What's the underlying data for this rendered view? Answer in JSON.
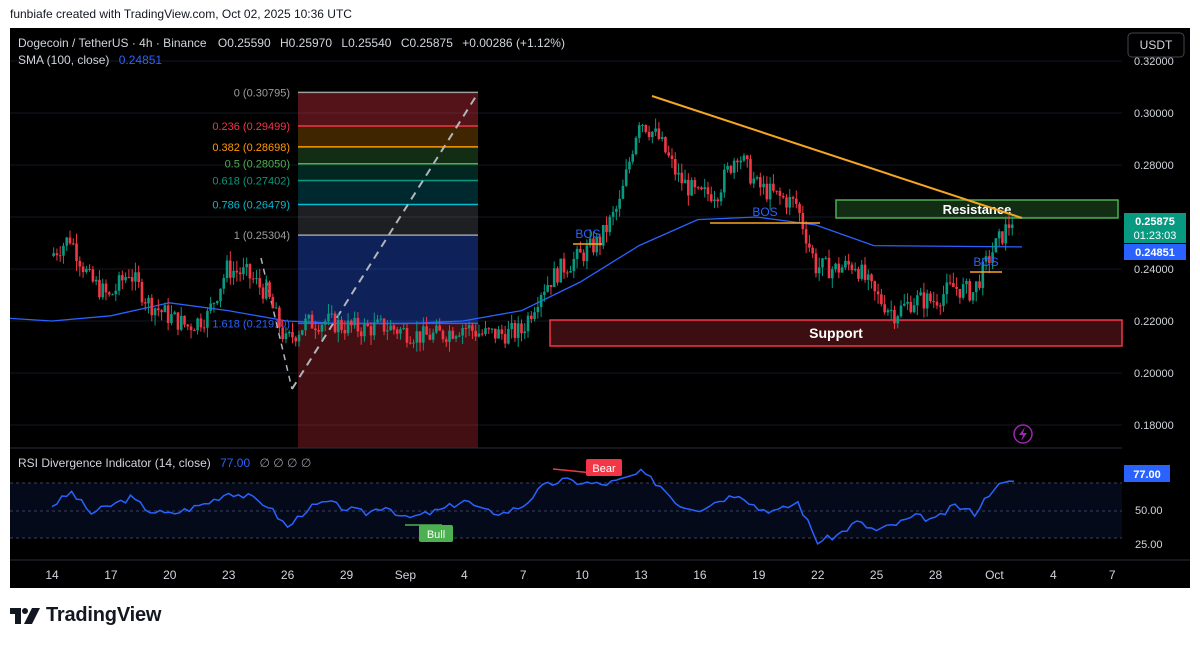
{
  "header": {
    "credit": "funbiafe created with TradingView.com, Oct 02, 2025 10:36 UTC"
  },
  "legend": {
    "symbol": "Dogecoin / TetherUS · 4h · Binance",
    "open_label": "O",
    "open": "0.25590",
    "high_label": "H",
    "high": "0.25970",
    "low_label": "L",
    "low": "0.25540",
    "close_label": "C",
    "close": "0.25875",
    "change": "+0.00286 (+1.12%)",
    "sma_label": "SMA (100, close)",
    "sma_value": "0.24851"
  },
  "currency_button": "USDT",
  "price_axis": {
    "ticks": [
      "0.32000",
      "0.30000",
      "0.28000",
      "0.26000",
      "0.24000",
      "0.22000",
      "0.20000",
      "0.18000"
    ],
    "last_price": "0.25875",
    "countdown": "01:23:03",
    "sma_badge": "0.24851"
  },
  "fib_levels": [
    {
      "ratio": "0",
      "price": "0.30795",
      "label": "0 (0.30795)",
      "color": "#9e9e9e"
    },
    {
      "ratio": "0.236",
      "price": "0.29499",
      "label": "0.236 (0.29499)",
      "color": "#f23645"
    },
    {
      "ratio": "0.382",
      "price": "0.28698",
      "label": "0.382 (0.28698)",
      "color": "#ff9800"
    },
    {
      "ratio": "0.5",
      "price": "0.28050",
      "label": "0.5 (0.28050)",
      "color": "#4caf50"
    },
    {
      "ratio": "0.618",
      "price": "0.27402",
      "label": "0.618 (0.27402)",
      "color": "#089981"
    },
    {
      "ratio": "0.786",
      "price": "0.26479",
      "label": "0.786 (0.26479)",
      "color": "#00bcd4"
    },
    {
      "ratio": "1",
      "price": "0.25304",
      "label": "1 (0.25304)",
      "color": "#9e9e9e"
    },
    {
      "ratio": "1.618",
      "price": "0.21910",
      "label": "1.618 (0.21910)",
      "color": "#2962ff"
    }
  ],
  "annotations": {
    "resistance": "Resistance",
    "support": "Support",
    "bos_1": "BOS",
    "bos_2": "BOS",
    "bos_3": "BOS",
    "bear": "Bear",
    "bull": "Bull"
  },
  "rsi": {
    "title": "RSI Divergence Indicator (14, close)",
    "value": "77.00",
    "placeholders": "∅ ∅ ∅ ∅",
    "ticks": [
      "50.00",
      "25.00"
    ],
    "badge": "77.00"
  },
  "time_axis": [
    "14",
    "17",
    "20",
    "23",
    "26",
    "29",
    "Sep",
    "4",
    "7",
    "10",
    "13",
    "16",
    "19",
    "22",
    "25",
    "28",
    "Oct",
    "4",
    "7"
  ],
  "footer": {
    "brand": "TradingView"
  },
  "colors": {
    "up": "#089981",
    "down": "#f23645",
    "sma": "#2962ff",
    "trend": "#f5a623",
    "rsi": "#2962ff",
    "resistance": "#4caf50",
    "support": "#f23645"
  },
  "chart_data": {
    "type": "candlestick",
    "instrument": "Dogecoin / TetherUS",
    "interval": "4h",
    "exchange": "Binance",
    "ylim": [
      0.17,
      0.325
    ],
    "x_labels": [
      "14",
      "17",
      "20",
      "23",
      "26",
      "29",
      "Sep",
      "4",
      "7",
      "10",
      "13",
      "16",
      "19",
      "22",
      "25",
      "28",
      "Oct",
      "4",
      "7"
    ],
    "approx_close_path": [
      {
        "x": "14",
        "y": 0.245
      },
      {
        "x": "15",
        "y": 0.252
      },
      {
        "x": "16",
        "y": 0.236
      },
      {
        "x": "17",
        "y": 0.229
      },
      {
        "x": "18",
        "y": 0.239
      },
      {
        "x": "19",
        "y": 0.227
      },
      {
        "x": "20",
        "y": 0.222
      },
      {
        "x": "21",
        "y": 0.218
      },
      {
        "x": "22",
        "y": 0.222
      },
      {
        "x": "23",
        "y": 0.24
      },
      {
        "x": "24",
        "y": 0.238
      },
      {
        "x": "25",
        "y": 0.231
      },
      {
        "x": "26",
        "y": 0.212
      },
      {
        "x": "27",
        "y": 0.219
      },
      {
        "x": "28",
        "y": 0.22
      },
      {
        "x": "29",
        "y": 0.218
      },
      {
        "x": "30",
        "y": 0.217
      },
      {
        "x": "31",
        "y": 0.218
      },
      {
        "x": "Sep",
        "y": 0.216
      },
      {
        "x": "2",
        "y": 0.214
      },
      {
        "x": "3",
        "y": 0.215
      },
      {
        "x": "4",
        "y": 0.218
      },
      {
        "x": "5",
        "y": 0.215
      },
      {
        "x": "6",
        "y": 0.215
      },
      {
        "x": "7",
        "y": 0.216
      },
      {
        "x": "8",
        "y": 0.232
      },
      {
        "x": "9",
        "y": 0.24
      },
      {
        "x": "10",
        "y": 0.245
      },
      {
        "x": "11",
        "y": 0.251
      },
      {
        "x": "12",
        "y": 0.265
      },
      {
        "x": "13",
        "y": 0.298
      },
      {
        "x": "14",
        "y": 0.29
      },
      {
        "x": "15",
        "y": 0.275
      },
      {
        "x": "16",
        "y": 0.268
      },
      {
        "x": "17",
        "y": 0.27
      },
      {
        "x": "18",
        "y": 0.285
      },
      {
        "x": "19",
        "y": 0.272
      },
      {
        "x": "20",
        "y": 0.268
      },
      {
        "x": "21",
        "y": 0.265
      },
      {
        "x": "22",
        "y": 0.241
      },
      {
        "x": "23",
        "y": 0.24
      },
      {
        "x": "24",
        "y": 0.242
      },
      {
        "x": "25",
        "y": 0.23
      },
      {
        "x": "26",
        "y": 0.223
      },
      {
        "x": "27",
        "y": 0.228
      },
      {
        "x": "28",
        "y": 0.228
      },
      {
        "x": "29",
        "y": 0.233
      },
      {
        "x": "30",
        "y": 0.231
      },
      {
        "x": "Oct",
        "y": 0.247
      },
      {
        "x": "2",
        "y": 0.259
      }
    ],
    "approx_sma100_path": [
      {
        "x": "14",
        "y": 0.22
      },
      {
        "x": "20",
        "y": 0.222
      },
      {
        "x": "26",
        "y": 0.227
      },
      {
        "x": "29",
        "y": 0.224
      },
      {
        "x": "Sep",
        "y": 0.22
      },
      {
        "x": "4",
        "y": 0.219
      },
      {
        "x": "7",
        "y": 0.219
      },
      {
        "x": "10",
        "y": 0.22
      },
      {
        "x": "13",
        "y": 0.224
      },
      {
        "x": "16",
        "y": 0.235
      },
      {
        "x": "19",
        "y": 0.249
      },
      {
        "x": "22",
        "y": 0.259
      },
      {
        "x": "25",
        "y": 0.26
      },
      {
        "x": "28",
        "y": 0.257
      },
      {
        "x": "Oct",
        "y": 0.249
      }
    ],
    "zones": {
      "resistance": [
        0.259,
        0.267
      ],
      "support": [
        0.21,
        0.22
      ]
    },
    "trendline": [
      {
        "x": "13",
        "y": 0.307
      },
      {
        "x": "Oct",
        "y": 0.259
      }
    ],
    "rsi_series": {
      "name": "RSI (14, close)",
      "ylim": [
        15,
        90
      ],
      "bands": [
        30,
        70
      ],
      "approx": [
        {
          "x": "14",
          "y": 55
        },
        {
          "x": "15",
          "y": 67
        },
        {
          "x": "16",
          "y": 48
        },
        {
          "x": "17",
          "y": 55
        },
        {
          "x": "18",
          "y": 62
        },
        {
          "x": "19",
          "y": 50
        },
        {
          "x": "20",
          "y": 47
        },
        {
          "x": "21",
          "y": 52
        },
        {
          "x": "22",
          "y": 58
        },
        {
          "x": "23",
          "y": 67
        },
        {
          "x": "24",
          "y": 63
        },
        {
          "x": "25",
          "y": 55
        },
        {
          "x": "26",
          "y": 35
        },
        {
          "x": "27",
          "y": 52
        },
        {
          "x": "28",
          "y": 58
        },
        {
          "x": "29",
          "y": 52
        },
        {
          "x": "30",
          "y": 48
        },
        {
          "x": "31",
          "y": 55
        },
        {
          "x": "Sep",
          "y": 43
        },
        {
          "x": "2",
          "y": 47
        },
        {
          "x": "3",
          "y": 52
        },
        {
          "x": "4",
          "y": 60
        },
        {
          "x": "5",
          "y": 50
        },
        {
          "x": "6",
          "y": 48
        },
        {
          "x": "7",
          "y": 55
        },
        {
          "x": "8",
          "y": 72
        },
        {
          "x": "9",
          "y": 78
        },
        {
          "x": "10",
          "y": 76
        },
        {
          "x": "11",
          "y": 74
        },
        {
          "x": "12",
          "y": 78
        },
        {
          "x": "13",
          "y": 85
        },
        {
          "x": "14",
          "y": 73
        },
        {
          "x": "15",
          "y": 55
        },
        {
          "x": "16",
          "y": 52
        },
        {
          "x": "17",
          "y": 60
        },
        {
          "x": "18",
          "y": 66
        },
        {
          "x": "19",
          "y": 52
        },
        {
          "x": "20",
          "y": 50
        },
        {
          "x": "21",
          "y": 58
        },
        {
          "x": "22",
          "y": 22
        },
        {
          "x": "23",
          "y": 28
        },
        {
          "x": "24",
          "y": 40
        },
        {
          "x": "25",
          "y": 32
        },
        {
          "x": "26",
          "y": 38
        },
        {
          "x": "27",
          "y": 45
        },
        {
          "x": "28",
          "y": 42
        },
        {
          "x": "29",
          "y": 55
        },
        {
          "x": "30",
          "y": 48
        },
        {
          "x": "Oct",
          "y": 72
        },
        {
          "x": "2",
          "y": 77
        }
      ]
    }
  }
}
